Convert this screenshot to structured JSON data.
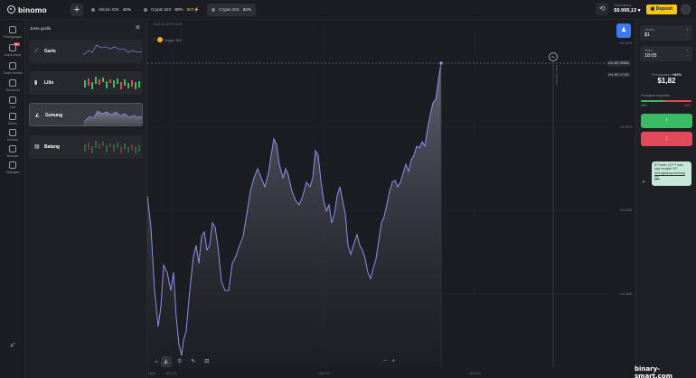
{
  "app": {
    "logo_text": "binomo"
  },
  "tabs": [
    {
      "name": "Altcoin IDX",
      "pct": "40%",
      "bonus": "",
      "active": false
    },
    {
      "name": "Crypto IDX",
      "pct": "80%",
      "bonus": "55T⚡",
      "active": false
    },
    {
      "name": "Crypto IDX",
      "pct": "82%",
      "bonus": "",
      "active": true
    }
  ],
  "account": {
    "label": "Akun demo",
    "balance": "$9.999,13 ▾",
    "deposit_label": "Deposit"
  },
  "leftnav": [
    {
      "label": "Perdagangan",
      "icon": "chart-icon",
      "badge": ""
    },
    {
      "label": "Acara sinyal",
      "icon": "signal-icon",
      "badge": "99+"
    },
    {
      "label": "Trader teratas",
      "icon": "trophy-icon",
      "badge": ""
    },
    {
      "label": "Turnamen",
      "icon": "cup-icon",
      "badge": ""
    },
    {
      "label": "Kuis",
      "icon": "quiz-icon",
      "badge": ""
    },
    {
      "label": "Bonus",
      "icon": "gift-icon",
      "badge": ""
    },
    {
      "label": "Edukasi",
      "icon": "education-icon",
      "badge": ""
    },
    {
      "label": "Bantuan",
      "icon": "help-icon",
      "badge": ""
    },
    {
      "label": "Tayangan",
      "icon": "video-icon",
      "badge": ""
    }
  ],
  "chart_types_panel": {
    "title": "Jenis grafik",
    "items": [
      {
        "label": "Garis",
        "icon": "line-chart-icon",
        "selected": false
      },
      {
        "label": "Lilin",
        "icon": "candle-chart-icon",
        "selected": false
      },
      {
        "label": "Gunung",
        "icon": "mountain-chart-icon",
        "selected": true
      },
      {
        "label": "Batang",
        "icon": "bar-chart-icon",
        "selected": false
      }
    ]
  },
  "chart": {
    "asset_label": "Crypto IDX",
    "header_time": "2022-01-30 07:11:09",
    "current_price": "641.867 80883",
    "second_price": "641.867 07363",
    "price_axis": [
      "641.8675",
      "641.8670",
      "641.8665",
      "641.8660"
    ],
    "time_axis": [
      "18:00",
      "18:01:00",
      "18:02:00",
      "18:03:00"
    ],
    "timer": "01",
    "vertical_label": "Waktu pembelian",
    "toolbar_timeframe": "5s"
  },
  "trade": {
    "amount_label": "Jumlah",
    "amount_value": "$1",
    "time_label": "Waktu",
    "time_value": "18:05",
    "profit_label": "Pendapatan",
    "profit_pct": "+82%",
    "profit_value": "$1,82",
    "sentiment_label": "Pendapat mayoritas",
    "sentiment_up": 0.46,
    "sentiment_up_label": "46%",
    "sentiment_down_label": "54%",
    "up_color": "#3dbb64",
    "down_color": "#e04a59",
    "up_arrow": "↑",
    "down_arrow": "↓"
  },
  "notice": {
    "text": "El Trader 137*** baru saja menjadi VIP. ",
    "link": "Selengkapnya tentang VIP"
  },
  "watermark": "binary-smart.com"
}
